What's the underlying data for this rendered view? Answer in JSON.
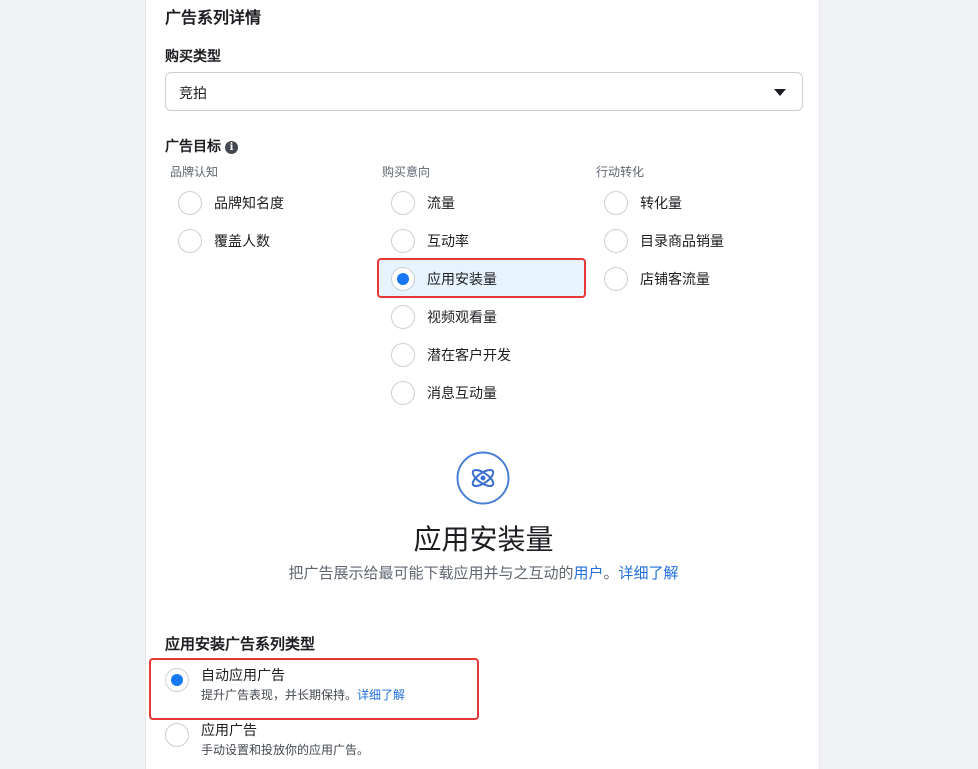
{
  "section": {
    "title": "广告系列详情"
  },
  "buying_type": {
    "label": "购买类型",
    "selected": "竞拍"
  },
  "objective": {
    "label": "广告目标",
    "columns": [
      {
        "heading": "品牌认知",
        "options": [
          {
            "label": "品牌知名度",
            "checked": false
          },
          {
            "label": "覆盖人数",
            "checked": false
          }
        ]
      },
      {
        "heading": "购买意向",
        "options": [
          {
            "label": "流量",
            "checked": false
          },
          {
            "label": "互动率",
            "checked": false
          },
          {
            "label": "应用安装量",
            "checked": true
          },
          {
            "label": "视频观看量",
            "checked": false
          },
          {
            "label": "潜在客户开发",
            "checked": false
          },
          {
            "label": "消息互动量",
            "checked": false
          }
        ]
      },
      {
        "heading": "行动转化",
        "options": [
          {
            "label": "转化量",
            "checked": false
          },
          {
            "label": "目录商品销量",
            "checked": false
          },
          {
            "label": "店铺客流量",
            "checked": false
          }
        ]
      }
    ]
  },
  "hero": {
    "icon": "atom-icon",
    "title": "应用安装量",
    "desc_prefix": "把广告展示给最可能下载应用并与之互动的",
    "desc_link_users": "用户",
    "desc_period": "。",
    "desc_link_learn": "详细了解"
  },
  "campaign_type": {
    "title": "应用安装广告系列类型",
    "options": [
      {
        "label": "自动应用广告",
        "desc": "提升广告表现，并长期保持。",
        "link": "详细了解",
        "checked": true
      },
      {
        "label": "应用广告",
        "desc": "手动设置和投放你的应用广告。",
        "checked": false
      }
    ]
  },
  "colors": {
    "accent": "#1877f2",
    "link": "#216fdb",
    "highlight_border": "#e53935"
  }
}
